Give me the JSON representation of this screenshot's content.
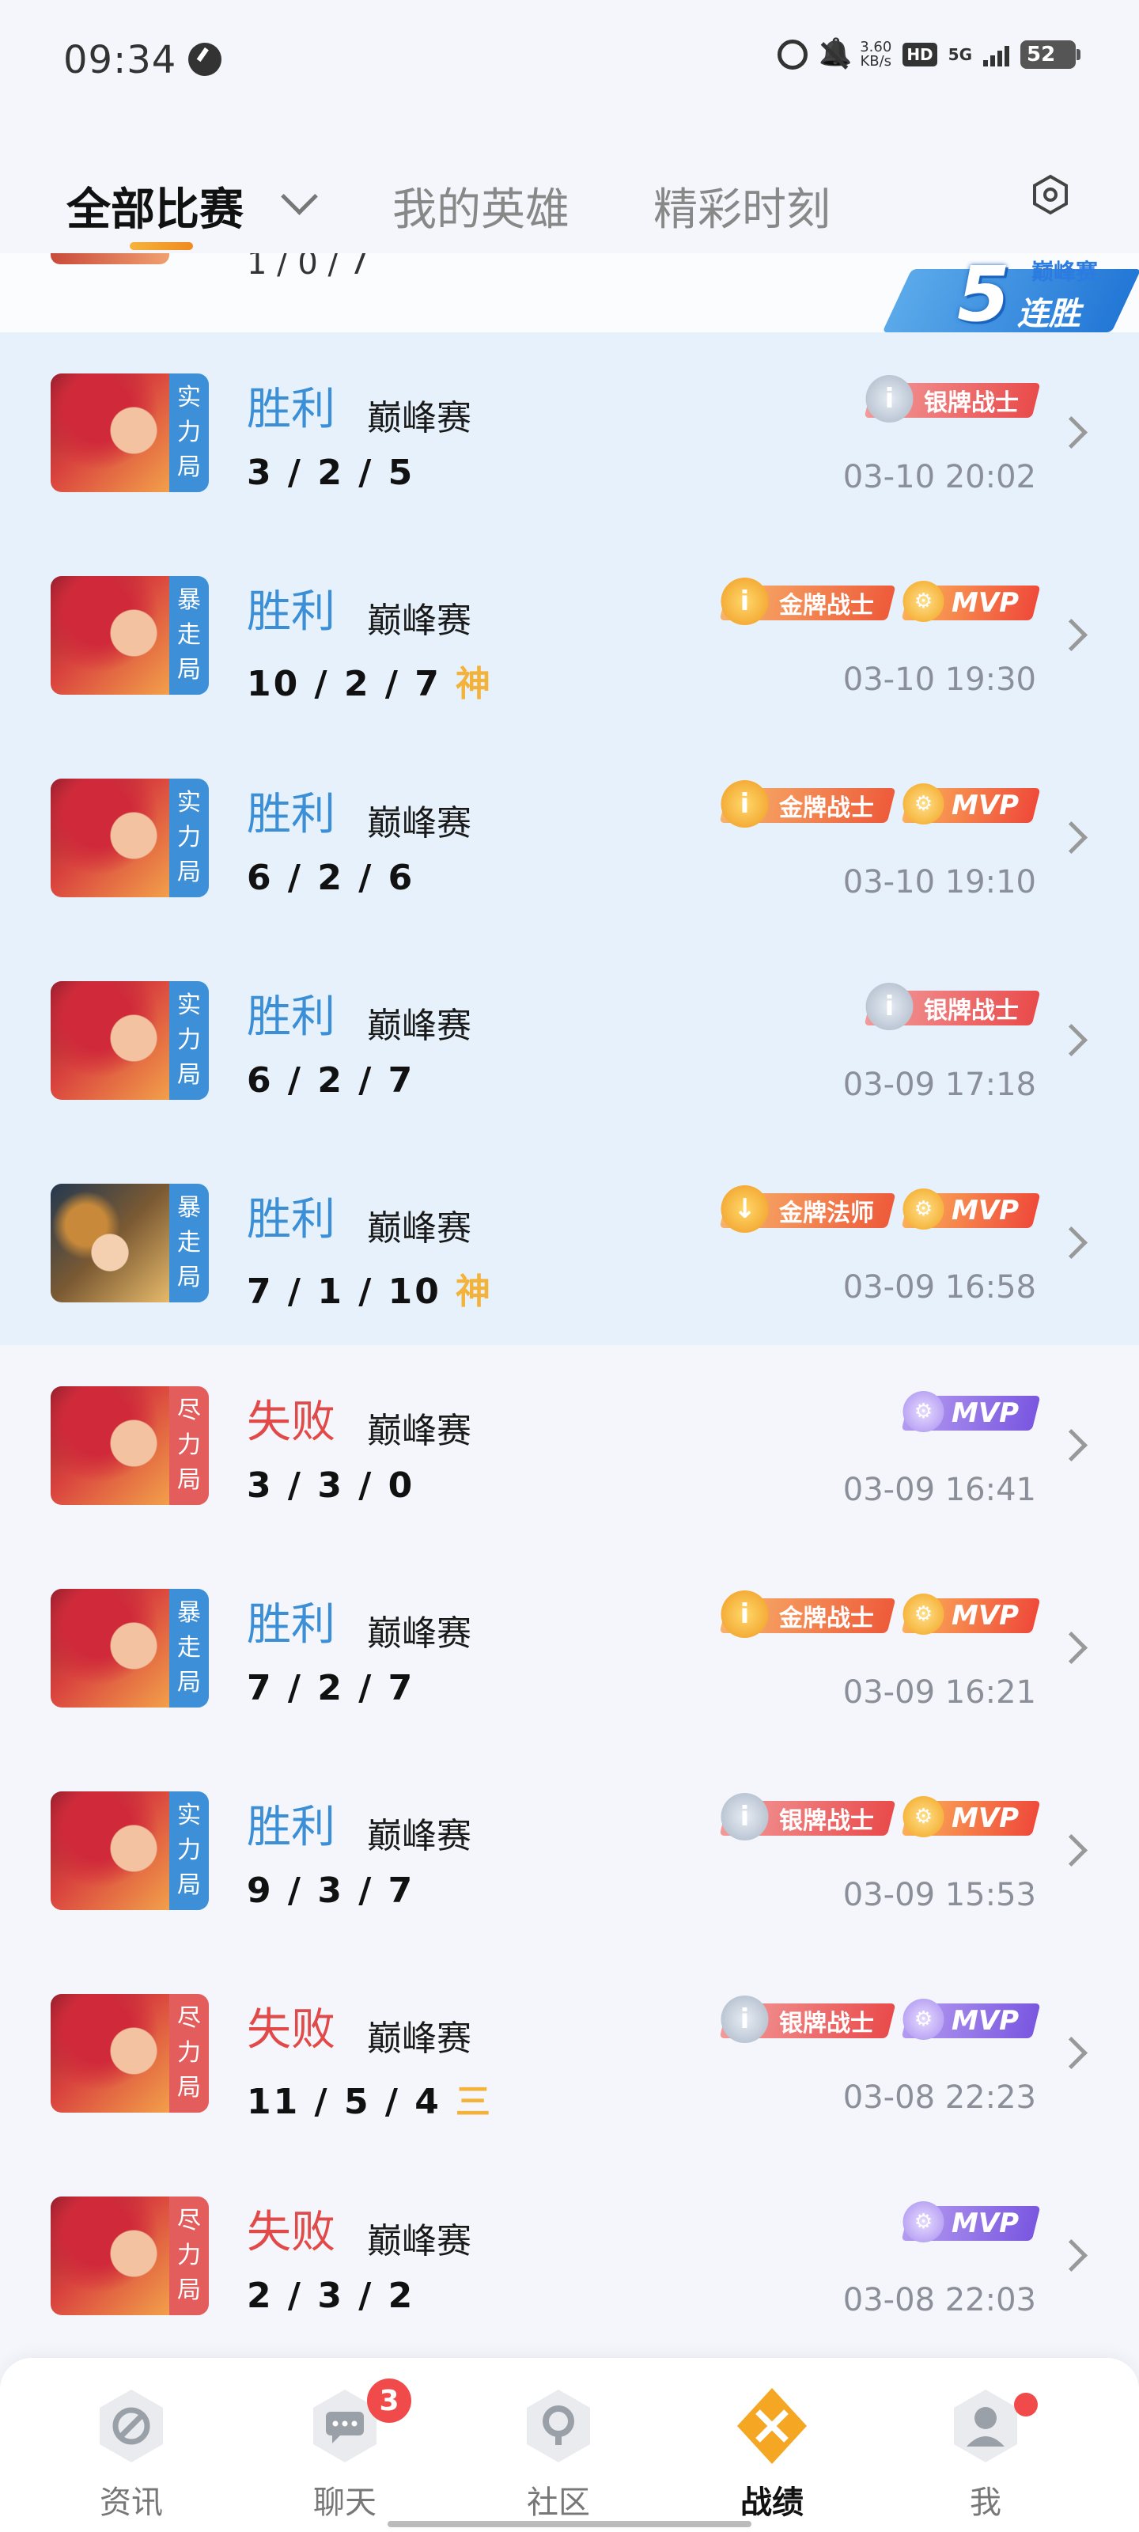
{
  "status_bar": {
    "time": "09:34",
    "net_speed_value": "3.60",
    "net_speed_unit": "KB/s",
    "hd": "HD",
    "network": "5G",
    "battery": "52"
  },
  "tabs": [
    {
      "label": "全部比赛",
      "active": true
    },
    {
      "label": "我的英雄",
      "active": false
    },
    {
      "label": "精彩时刻",
      "active": false
    }
  ],
  "peek_row": {
    "kda": "1 / 0 / 7",
    "streak": {
      "number": "5",
      "top_label": "巅峰赛",
      "bottom_label": "连胜"
    }
  },
  "matches": [
    {
      "result": "胜利",
      "outcome": "win",
      "mode": "巅峰赛",
      "kda": "3 / 2 / 5",
      "kda_badge": "",
      "tag": [
        "实",
        "力",
        "局"
      ],
      "tag_color": "blue",
      "hero": "a",
      "time": "03-10 20:02",
      "highlight": true,
      "badges": [
        {
          "type": "silver",
          "medal": "i",
          "label": "银牌战士"
        }
      ]
    },
    {
      "result": "胜利",
      "outcome": "win",
      "mode": "巅峰赛",
      "kda": "10 / 2 / 7",
      "kda_badge": "神",
      "tag": [
        "暴",
        "走",
        "局"
      ],
      "tag_color": "blue",
      "hero": "a",
      "time": "03-10 19:30",
      "highlight": true,
      "badges": [
        {
          "type": "gold",
          "medal": "i",
          "label": "金牌战士"
        },
        {
          "type": "mvp-gold",
          "medal": "⚙",
          "label": "MVP"
        }
      ]
    },
    {
      "result": "胜利",
      "outcome": "win",
      "mode": "巅峰赛",
      "kda": "6 / 2 / 6",
      "kda_badge": "",
      "tag": [
        "实",
        "力",
        "局"
      ],
      "tag_color": "blue",
      "hero": "a",
      "time": "03-10 19:10",
      "highlight": true,
      "badges": [
        {
          "type": "gold",
          "medal": "i",
          "label": "金牌战士"
        },
        {
          "type": "mvp-gold",
          "medal": "⚙",
          "label": "MVP"
        }
      ]
    },
    {
      "result": "胜利",
      "outcome": "win",
      "mode": "巅峰赛",
      "kda": "6 / 2 / 7",
      "kda_badge": "",
      "tag": [
        "实",
        "力",
        "局"
      ],
      "tag_color": "blue",
      "hero": "a",
      "time": "03-09 17:18",
      "highlight": true,
      "badges": [
        {
          "type": "silver",
          "medal": "i",
          "label": "银牌战士"
        }
      ]
    },
    {
      "result": "胜利",
      "outcome": "win",
      "mode": "巅峰赛",
      "kda": "7 / 1 / 10",
      "kda_badge": "神",
      "tag": [
        "暴",
        "走",
        "局"
      ],
      "tag_color": "blue",
      "hero": "b",
      "time": "03-09 16:58",
      "highlight": true,
      "badges": [
        {
          "type": "gold",
          "medal": "↓",
          "label": "金牌法师"
        },
        {
          "type": "mvp-gold",
          "medal": "⚙",
          "label": "MVP"
        }
      ]
    },
    {
      "result": "失败",
      "outcome": "loss",
      "mode": "巅峰赛",
      "kda": "3 / 3 / 0",
      "kda_badge": "",
      "tag": [
        "尽",
        "力",
        "局"
      ],
      "tag_color": "red",
      "hero": "a",
      "time": "03-09 16:41",
      "highlight": false,
      "badges": [
        {
          "type": "mvp-purple",
          "medal": "⚙",
          "label": "MVP"
        }
      ]
    },
    {
      "result": "胜利",
      "outcome": "win",
      "mode": "巅峰赛",
      "kda": "7 / 2 / 7",
      "kda_badge": "",
      "tag": [
        "暴",
        "走",
        "局"
      ],
      "tag_color": "blue",
      "hero": "a",
      "time": "03-09 16:21",
      "highlight": false,
      "badges": [
        {
          "type": "gold",
          "medal": "i",
          "label": "金牌战士"
        },
        {
          "type": "mvp-gold",
          "medal": "⚙",
          "label": "MVP"
        }
      ]
    },
    {
      "result": "胜利",
      "outcome": "win",
      "mode": "巅峰赛",
      "kda": "9 / 3 / 7",
      "kda_badge": "",
      "tag": [
        "实",
        "力",
        "局"
      ],
      "tag_color": "blue",
      "hero": "a",
      "time": "03-09 15:53",
      "highlight": false,
      "badges": [
        {
          "type": "silver",
          "medal": "i",
          "label": "银牌战士"
        },
        {
          "type": "mvp-gold",
          "medal": "⚙",
          "label": "MVP"
        }
      ]
    },
    {
      "result": "失败",
      "outcome": "loss",
      "mode": "巅峰赛",
      "kda": "11 / 5 / 4",
      "kda_badge": "三",
      "tag": [
        "尽",
        "力",
        "局"
      ],
      "tag_color": "red",
      "hero": "a",
      "time": "03-08 22:23",
      "highlight": false,
      "badges": [
        {
          "type": "silver",
          "medal": "i",
          "label": "银牌战士"
        },
        {
          "type": "mvp-purple",
          "medal": "⚙",
          "label": "MVP"
        }
      ]
    },
    {
      "result": "失败",
      "outcome": "loss",
      "mode": "巅峰赛",
      "kda": "2 / 3 / 2",
      "kda_badge": "",
      "tag": [
        "尽",
        "力",
        "局"
      ],
      "tag_color": "red",
      "hero": "a",
      "time": "03-08 22:03",
      "highlight": false,
      "badges": [
        {
          "type": "mvp-purple",
          "medal": "⚙",
          "label": "MVP"
        }
      ]
    }
  ],
  "bottom_nav": [
    {
      "label": "资讯",
      "icon": "news-icon",
      "badge": "",
      "dot": false,
      "active": false
    },
    {
      "label": "聊天",
      "icon": "chat-icon",
      "badge": "3",
      "dot": false,
      "active": false
    },
    {
      "label": "社区",
      "icon": "community-icon",
      "badge": "",
      "dot": false,
      "active": false
    },
    {
      "label": "战绩",
      "icon": "battle-record-icon",
      "badge": "",
      "dot": false,
      "active": true
    },
    {
      "label": "我",
      "icon": "profile-icon",
      "badge": "",
      "dot": true,
      "active": false
    }
  ],
  "colors": {
    "win": "#3a8fd6",
    "loss": "#e24a4a",
    "highlight_bg": "#e6f1fb",
    "accent": "#f5a623"
  }
}
